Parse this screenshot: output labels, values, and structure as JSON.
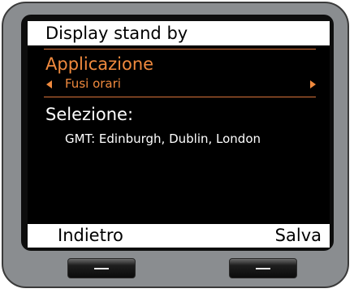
{
  "screen": {
    "title": "Display stand by",
    "setting": {
      "label": "Applicazione",
      "value": "Fusi orari",
      "prev_icon": "triangle-left-icon",
      "next_icon": "triangle-right-icon"
    },
    "selection": {
      "label": "Selezione:",
      "value": "GMT: Edinburgh, Dublin, London"
    },
    "softkeys": {
      "left": "Indietro",
      "right": "Salva"
    }
  },
  "colors": {
    "accent": "#f08a3e",
    "screen_background": "#000000",
    "bar_background": "#ffffff",
    "device_body": "#8a8d90"
  },
  "hardware": {
    "left_button_icon": "dash-icon",
    "right_button_icon": "dash-icon"
  }
}
